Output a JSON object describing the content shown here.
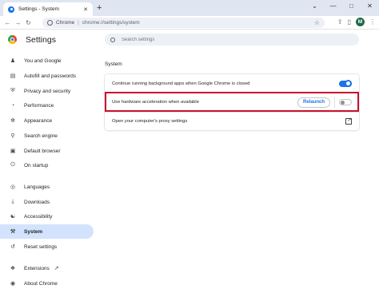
{
  "window": {
    "tab_title": "Settings - System",
    "tab_close": "✕",
    "new_tab": "+",
    "controls": [
      "⌄",
      "—",
      "□",
      "✕"
    ]
  },
  "toolbar": {
    "back": "←",
    "forward": "→",
    "reload": "↻",
    "site_label": "Chrome",
    "url": "chrome://settings/system",
    "profile_initial": "M"
  },
  "header": {
    "title": "Settings",
    "search_placeholder": "Search settings"
  },
  "sidebar": {
    "items": [
      {
        "label": "You and Google",
        "icon": "person-icon"
      },
      {
        "label": "Autofill and passwords",
        "icon": "clipboard-icon"
      },
      {
        "label": "Privacy and security",
        "icon": "shield-icon"
      },
      {
        "label": "Performance",
        "icon": "speedometer-icon"
      },
      {
        "label": "Appearance",
        "icon": "palette-icon"
      },
      {
        "label": "Search engine",
        "icon": "search-icon"
      },
      {
        "label": "Default browser",
        "icon": "browser-icon"
      },
      {
        "label": "On startup",
        "icon": "power-icon"
      },
      {
        "label": "Languages",
        "icon": "globe-icon"
      },
      {
        "label": "Downloads",
        "icon": "download-icon"
      },
      {
        "label": "Accessibility",
        "icon": "accessibility-icon"
      },
      {
        "label": "System",
        "icon": "wrench-icon",
        "active": true
      },
      {
        "label": "Reset settings",
        "icon": "reset-icon"
      },
      {
        "label": "Extensions",
        "icon": "puzzle-icon"
      },
      {
        "label": "About Chrome",
        "icon": "chrome-icon"
      }
    ]
  },
  "main": {
    "section_title": "System",
    "rows": [
      {
        "label": "Continue running background apps when Google Chrome is closed",
        "toggle": true
      },
      {
        "label": "Use hardware acceleration when available",
        "toggle": false,
        "button": "Relaunch"
      },
      {
        "label": "Open your computer's proxy settings"
      }
    ]
  },
  "colors": {
    "accent": "#1a73e8",
    "highlight_border": "#c8102e",
    "active_nav": "#d3e3fd"
  }
}
